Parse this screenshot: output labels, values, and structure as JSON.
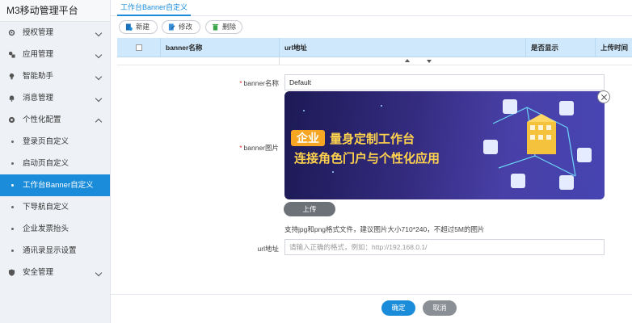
{
  "app": {
    "title": "M3移动管理平台"
  },
  "sidebar": {
    "items": [
      {
        "label": "授权管理",
        "icon": "gear-icon"
      },
      {
        "label": "应用管理",
        "icon": "apps-icon"
      },
      {
        "label": "智能助手",
        "icon": "bulb-icon"
      },
      {
        "label": "消息管理",
        "icon": "bell-icon"
      },
      {
        "label": "个性化配置",
        "icon": "palette-icon"
      }
    ],
    "subitems": [
      {
        "label": "登录页自定义"
      },
      {
        "label": "启动页自定义"
      },
      {
        "label": "工作台Banner自定义"
      },
      {
        "label": "下导航自定义"
      },
      {
        "label": "企业发票抬头"
      },
      {
        "label": "通讯录显示设置"
      }
    ],
    "last": {
      "label": "安全管理",
      "icon": "shield-icon"
    }
  },
  "tabs": {
    "active": "工作台Banner自定义"
  },
  "toolbar": {
    "new": "新建",
    "edit": "修改",
    "delete": "删除"
  },
  "grid": {
    "columns": [
      "banner名称",
      "url地址",
      "是否显示",
      "上传时间"
    ]
  },
  "form": {
    "name_label": "banner名称",
    "name_value": "Default",
    "image_label": "banner图片",
    "upload": "上传",
    "hint": "支持jpg和png格式文件，建议图片大小710*240，不超过5M的图片",
    "url_label": "url地址",
    "url_placeholder": "请输入正确的格式，例如：http://192.168.0.1/"
  },
  "banner": {
    "badge": "企业",
    "line1": "量身定制工作台",
    "line2": "连接角色门户与个性化应用"
  },
  "footer": {
    "ok": "确定",
    "cancel": "取消"
  },
  "colors": {
    "accent": "#1b8cd9",
    "header_bg": "#cfe8fb",
    "sidebar_bg": "#eef1f6"
  }
}
